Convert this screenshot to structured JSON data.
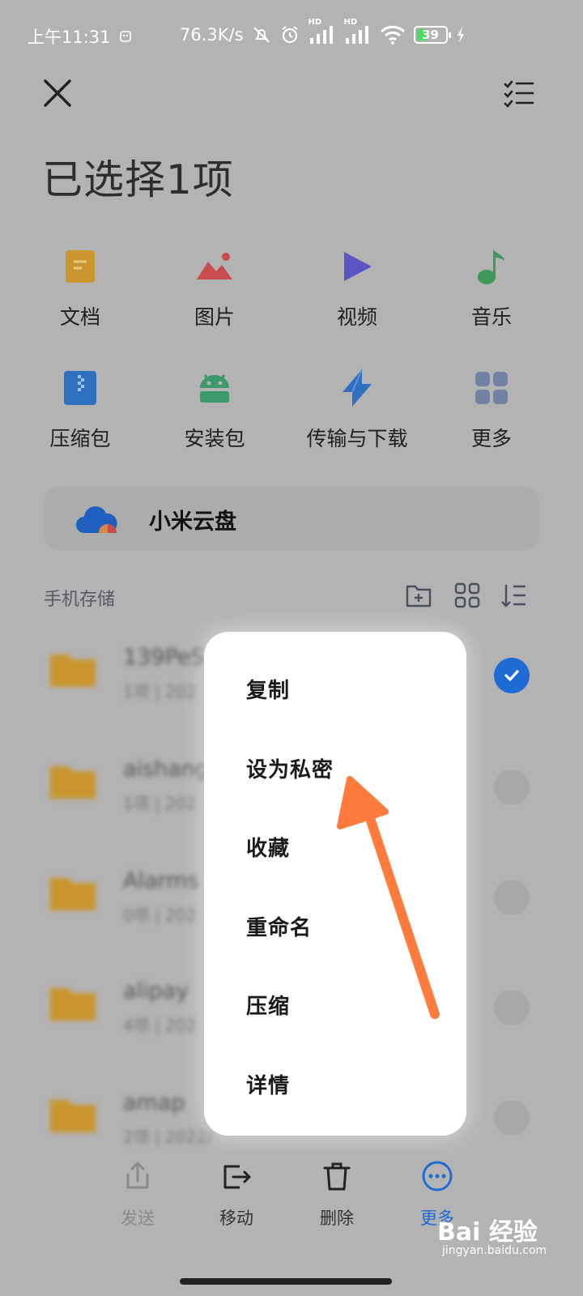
{
  "status_bar": {
    "time": "上午11:31",
    "net_speed": "76.3K/s",
    "hd1": "HD",
    "hd2": "HD",
    "battery": "39"
  },
  "header": {
    "title": "已选择1项"
  },
  "categories": [
    {
      "label": "文档",
      "icon": "document-icon",
      "color": "#c9962f"
    },
    {
      "label": "图片",
      "icon": "image-icon",
      "color": "#c94c4c"
    },
    {
      "label": "视频",
      "icon": "video-play-icon",
      "color": "#5b54c2"
    },
    {
      "label": "音乐",
      "icon": "music-note-icon",
      "color": "#3e9a5c"
    },
    {
      "label": "压缩包",
      "icon": "zip-icon",
      "color": "#2f6fc0"
    },
    {
      "label": "安装包",
      "icon": "android-icon",
      "color": "#3c9a6a"
    },
    {
      "label": "传输与下载",
      "icon": "transfer-icon",
      "color": "#2f6fc0"
    },
    {
      "label": "更多",
      "icon": "more-grid-icon",
      "color": "#7381a3"
    }
  ],
  "cloud": {
    "label": "小米云盘"
  },
  "storage": {
    "label": "手机存储"
  },
  "files": [
    {
      "name": "139PeS",
      "meta": "1项 | 202",
      "checked": true
    },
    {
      "name": "aishang",
      "meta": "1项 | 202",
      "checked": false
    },
    {
      "name": "Alarms",
      "meta": "0项 | 202",
      "checked": false
    },
    {
      "name": "alipay",
      "meta": "4项 | 202",
      "checked": false
    },
    {
      "name": "amap",
      "meta": "2项 | 2022/",
      "checked": false
    }
  ],
  "menu": {
    "items": [
      "复制",
      "设为私密",
      "收藏",
      "重命名",
      "压缩",
      "详情"
    ]
  },
  "actions": [
    {
      "label": "发送",
      "icon": "share-icon",
      "state": "disabled"
    },
    {
      "label": "移动",
      "icon": "move-icon",
      "state": "normal"
    },
    {
      "label": "删除",
      "icon": "trash-icon",
      "state": "normal"
    },
    {
      "label": "更多",
      "icon": "more-icon",
      "state": "active"
    }
  ],
  "watermark": {
    "brand": "Bai 经验",
    "url": "jingyan.baidu.com"
  },
  "colors": {
    "accent": "#1f6bd6",
    "annotation_arrow": "#ff7a3d",
    "dim_background": "#b3b3b3"
  }
}
